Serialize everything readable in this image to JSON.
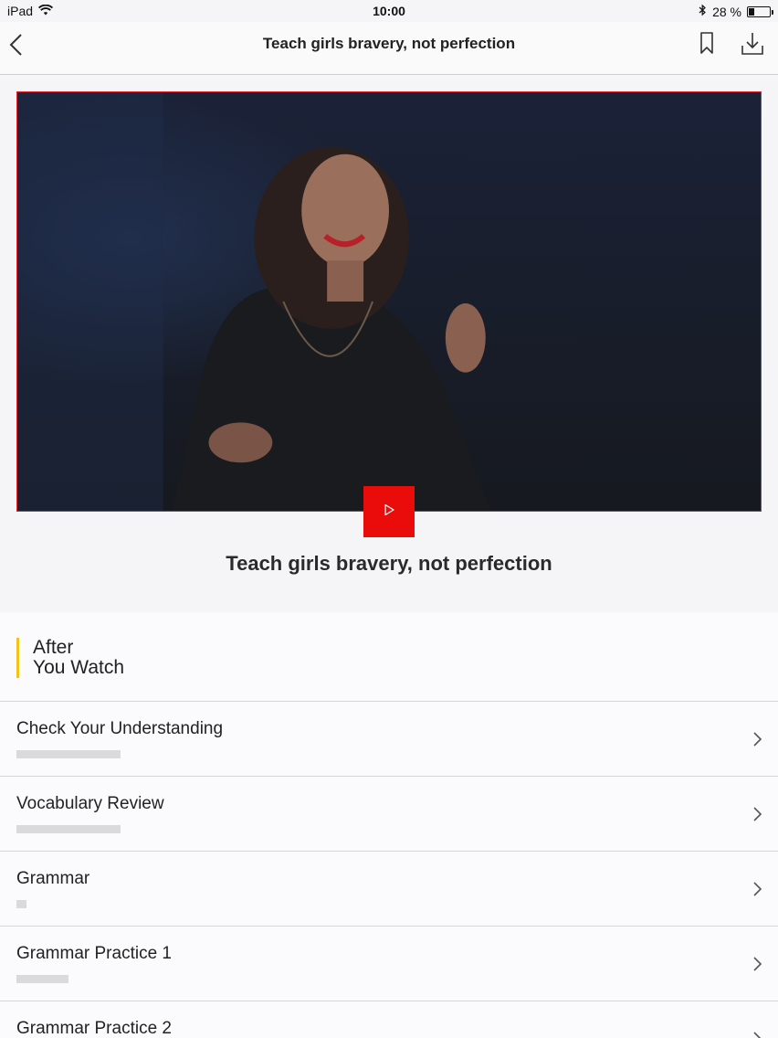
{
  "status_bar": {
    "device": "iPad",
    "time": "10:00",
    "battery_text": "28 %",
    "battery_level": 0.28
  },
  "nav": {
    "title": "Teach girls bravery, not perfection",
    "back_icon": "chevron-left-icon",
    "bookmark_icon": "bookmark-icon",
    "download_icon": "download-icon"
  },
  "video": {
    "play_icon": "play-icon",
    "accent_color": "#ea0b0b"
  },
  "talk": {
    "title": "Teach girls bravery, not perfection"
  },
  "section": {
    "heading_line1": "After",
    "heading_line2": "You Watch",
    "accent_color": "#f0c419",
    "items": [
      {
        "label": "Check Your Understanding",
        "dots": 10
      },
      {
        "label": "Vocabulary Review",
        "dots": 10
      },
      {
        "label": "Grammar",
        "dots": 1
      },
      {
        "label": "Grammar Practice 1",
        "dots": 5
      },
      {
        "label": "Grammar Practice 2",
        "dots": 0
      }
    ]
  }
}
